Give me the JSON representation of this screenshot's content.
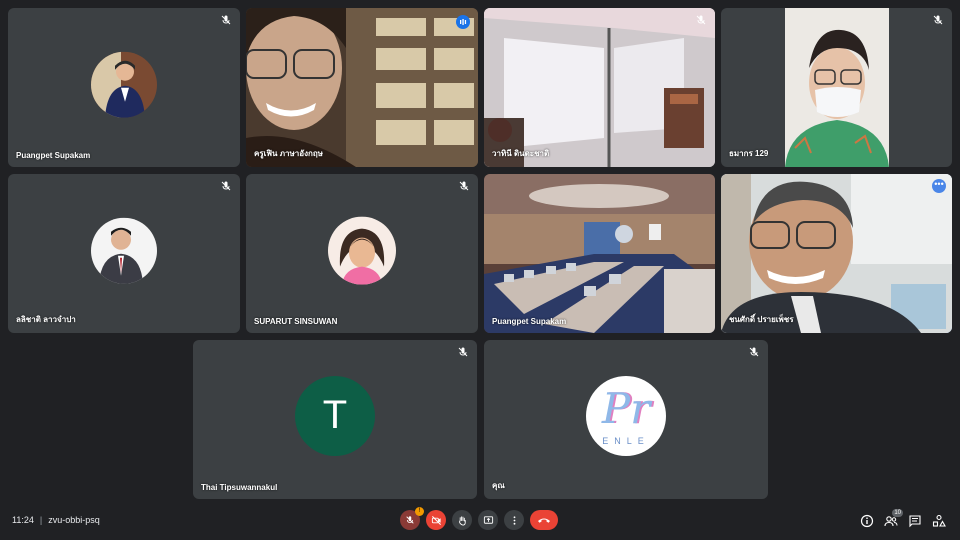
{
  "participants": [
    {
      "name": "Puangpet Supakam",
      "muted": true
    },
    {
      "name": "ครูเฟิน ภาษาอังกฤษ",
      "muted": false,
      "speaking": true
    },
    {
      "name": "วาทินี ดินดะชาติ",
      "muted": true
    },
    {
      "name": "ธมากร 129",
      "muted": true
    },
    {
      "name": "ลลิชาติ ลาวจำปา",
      "muted": true
    },
    {
      "name": "SUPARUT SINSUWAN",
      "muted": true
    },
    {
      "name": "Puangpet Supakam",
      "muted": true
    },
    {
      "name": "ชนศักดิ์ ปรายเพ็ชร",
      "muted": false,
      "active": true
    },
    {
      "name": "Thai Tipsuwannakul",
      "muted": true,
      "initial": "T"
    },
    {
      "name": "คุณ",
      "muted": true,
      "logo_text": "Pr",
      "logo_sub": "ENLE"
    }
  ],
  "meeting": {
    "time": "11:24",
    "code": "zvu-obbi-psq"
  },
  "controls": {
    "mic_warning": "!",
    "people_count": "10"
  },
  "colors": {
    "background": "#202124",
    "tile": "#3c4043",
    "end_call": "#ea4335",
    "active_outline": "#8ab4f8",
    "letter_avatar": "#0d5e46"
  }
}
